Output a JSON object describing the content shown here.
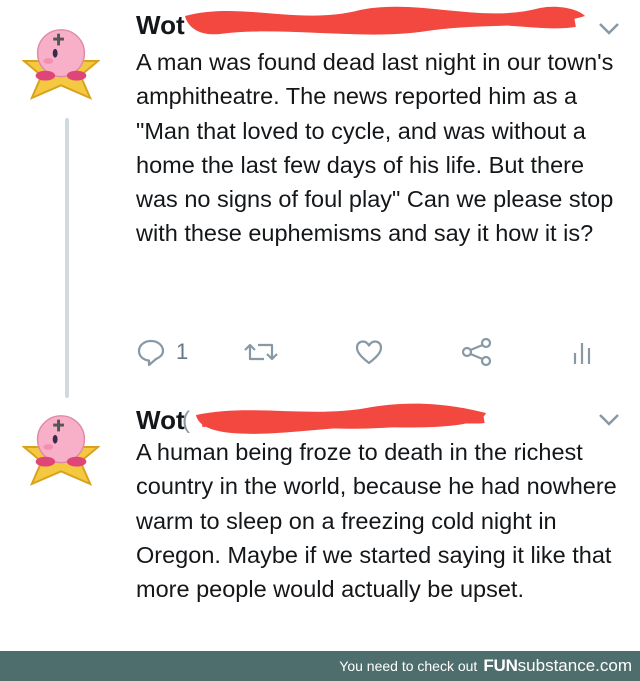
{
  "tweets": [
    {
      "author_name": "Wot",
      "text": "A man was found dead last night in our town's amphitheatre. The news reported him as a \"Man that loved to cycle, and was without a home the last few days of his life. But there was no signs of foul play\" Can we please stop with these euphemisms and say it how it is?",
      "reply_count": "1",
      "icons": [
        "reply-icon",
        "retweet-icon",
        "like-icon",
        "share-icon",
        "analytics-icon"
      ]
    },
    {
      "author_name": "Wot",
      "handle_prefix": "(",
      "text": "A human being froze to death in the richest country in the world, because he had nowhere warm to sleep on a freezing cold night in Oregon. Maybe if we started saying it like that more people would actually be upset."
    }
  ],
  "footer": {
    "text": "You need to check out",
    "brand_bold": "FUN",
    "brand_light": "substance",
    "brand_suffix": ".com"
  },
  "colors": {
    "redaction": "#f2483f",
    "icon_gray": "#8899a6",
    "footer_bg": "#4e6e6d"
  }
}
